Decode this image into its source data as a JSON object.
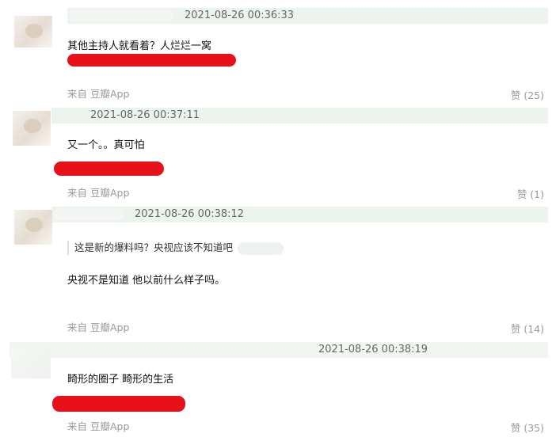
{
  "comments": [
    {
      "timestamp": "2021-08-26 00:36:33",
      "text": "其他主持人就看着？人烂烂一窝",
      "source": "来自 豆瓣App",
      "likes": "赞 (25)"
    },
    {
      "timestamp": "2021-08-26 00:37:11",
      "text": "又一个。。真可怕",
      "source": "来自 豆瓣App",
      "likes": "赞 (1)"
    },
    {
      "timestamp": "2021-08-26 00:38:12",
      "quote": "这是新的爆料吗？央视应该不知道吧",
      "text": "央视不是知道 他以前什么样子吗。",
      "source": "来自 豆瓣App",
      "likes": "赞 (14)"
    },
    {
      "timestamp": "2021-08-26 00:38:19",
      "text": "畸形的圈子 畸形的生活",
      "source": "来自 豆瓣App",
      "likes": "赞 (35)"
    }
  ],
  "colors": {
    "header_band": "#edf4ed",
    "redaction": "#e8111b",
    "muted_text": "#9a9a9a"
  }
}
